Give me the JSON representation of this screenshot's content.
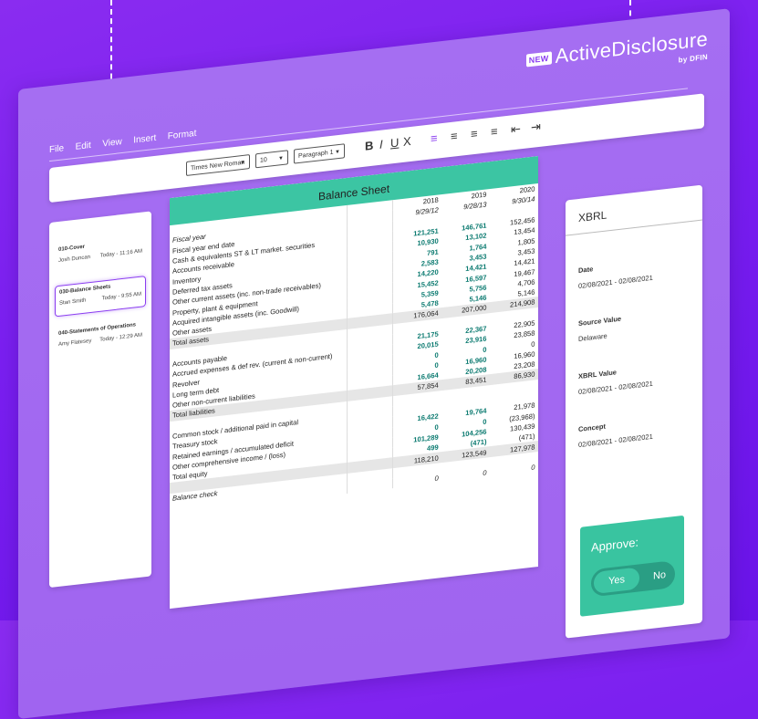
{
  "brand": {
    "new_badge": "NEW",
    "name": "ActiveDisclosure",
    "byline": "by DFIN"
  },
  "menu": [
    "File",
    "Edit",
    "View",
    "Insert",
    "Format"
  ],
  "toolbar": {
    "font": "Times New Roman",
    "size": "10",
    "style": "Paragraph 1",
    "bold": "B",
    "italic": "I",
    "underline": "U",
    "clear": "X"
  },
  "documents": [
    {
      "title": "010-Cover",
      "user": "Josh Duncan",
      "time": "Today - 11:16 AM"
    },
    {
      "title": "030-Balance Sheets",
      "user": "Stan Smith",
      "time": "Today - 9:55 AM"
    },
    {
      "title": "040-Statements of Operations",
      "user": "Amy Flatesey",
      "time": "Today - 12:29 AM"
    }
  ],
  "sheet": {
    "title": "Balance Sheet",
    "years": [
      "2018",
      "2019",
      "2020"
    ],
    "rows": [
      {
        "label": "Fiscal year",
        "v": [
          "9/29/12",
          "9/28/13",
          "9/30/14"
        ],
        "style": "hdr"
      },
      {
        "label": "Fiscal year end date",
        "v": [
          "",
          "",
          ""
        ]
      },
      {
        "label": "Cash & equivalents ST & LT market. securities",
        "v": [
          "121,251",
          "146,761",
          "152,456"
        ],
        "g": true
      },
      {
        "label": "Accounts receivable",
        "v": [
          "10,930",
          "13,102",
          "13,454"
        ],
        "g": true
      },
      {
        "label": "Inventory",
        "v": [
          "791",
          "1,764",
          "1,805"
        ],
        "g": true
      },
      {
        "label": "Deferred tax assets",
        "v": [
          "2,583",
          "3,453",
          "3,453"
        ],
        "g": true
      },
      {
        "label": "Other current assets (inc. non-trade receivables)",
        "v": [
          "14,220",
          "14,421",
          "14,421"
        ],
        "g": true
      },
      {
        "label": "Property, plant & equipment",
        "v": [
          "15,452",
          "16,597",
          "19,467"
        ],
        "g": true
      },
      {
        "label": "Acquired intangible assets (inc. Goodwill)",
        "v": [
          "5,359",
          "5,756",
          "4,706"
        ],
        "g": true
      },
      {
        "label": "Other assets",
        "v": [
          "5,478",
          "5,146",
          "5,146"
        ],
        "g": true
      },
      {
        "label": "Total assets",
        "v": [
          "176,064",
          "207,000",
          "214,908"
        ],
        "style": "tot"
      },
      {
        "label": "",
        "v": [
          "",
          "",
          ""
        ]
      },
      {
        "label": "Accounts payable",
        "v": [
          "21,175",
          "22,367",
          "22,905"
        ],
        "g": true
      },
      {
        "label": "Accrued expenses & def rev. (current & non-current)",
        "v": [
          "20,015",
          "23,916",
          "23,858"
        ],
        "g": true
      },
      {
        "label": "Revolver",
        "v": [
          "0",
          "0",
          "0"
        ],
        "g": true
      },
      {
        "label": "Long term debt",
        "v": [
          "0",
          "16,960",
          "16,960"
        ],
        "g": true
      },
      {
        "label": "Other non-current liabilities",
        "v": [
          "16,664",
          "20,208",
          "23,208"
        ],
        "g": true
      },
      {
        "label": "Total liabilities",
        "v": [
          "57,854",
          "83,451",
          "86,930"
        ],
        "style": "tot"
      },
      {
        "label": "",
        "v": [
          "",
          "",
          ""
        ]
      },
      {
        "label": "Common stock / additional paid in capital",
        "v": [
          "",
          "",
          ""
        ]
      },
      {
        "label": "Treasury stock",
        "v": [
          "16,422",
          "19,764",
          "21,978"
        ],
        "g": true
      },
      {
        "label": "Retained earnings / accumulated deficit",
        "v": [
          "0",
          "0",
          "(23,968)"
        ],
        "g": true
      },
      {
        "label": "Other comprehensive income / (loss)",
        "v": [
          "101,289",
          "104,256",
          "130,439"
        ],
        "g": true
      },
      {
        "label": "Total equity",
        "v": [
          "499",
          "(471)",
          "(471)"
        ],
        "g": true
      },
      {
        "label": "",
        "v": [
          "118,210",
          "123,549",
          "127,978"
        ],
        "style": "tot"
      },
      {
        "label": "Balance check",
        "v": [
          "",
          "",
          ""
        ],
        "style": "hdr"
      },
      {
        "label": "",
        "v": [
          "0",
          "0",
          "0"
        ],
        "style": "hdr"
      }
    ]
  },
  "xbrl": {
    "title": "XBRL",
    "fields": [
      {
        "key": "Date",
        "value": "02/08/2021 - 02/08/2021"
      },
      {
        "key": "Source Value",
        "value": "Delaware"
      },
      {
        "key": "XBRL Value",
        "value": "02/08/2021 - 02/08/2021"
      },
      {
        "key": "Concept",
        "value": "02/08/2021 - 02/08/2021"
      }
    ],
    "approve_label": "Approve:",
    "yes": "Yes",
    "no": "No"
  }
}
